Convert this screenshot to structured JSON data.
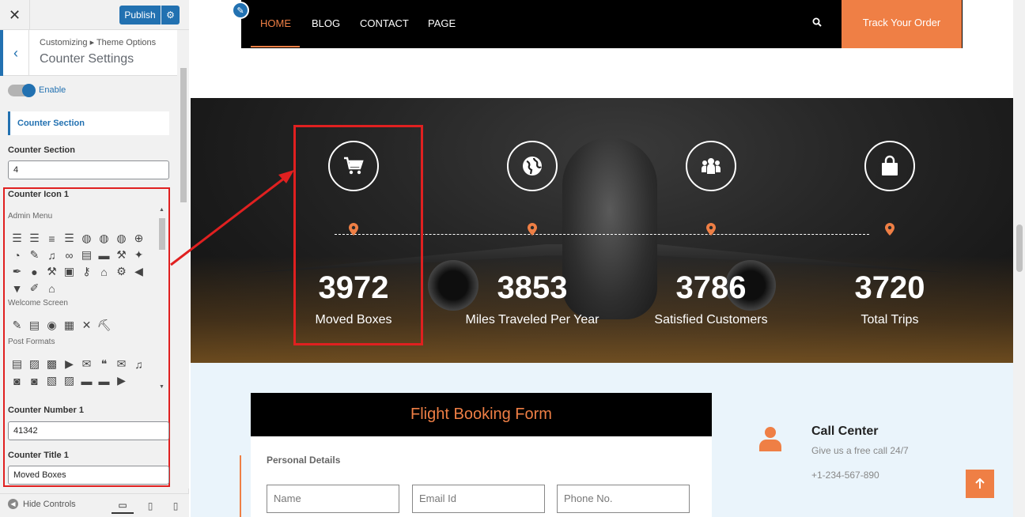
{
  "panel": {
    "close_icon": "close-icon",
    "publish_label": "Publish",
    "breadcrumb": "Customizing ▸ Theme Options",
    "section_title": "Counter Settings",
    "toggle_label": "Enable",
    "counter_section_heading": "Counter Section",
    "counter_section_label": "Counter Section",
    "counter_section_value": "4",
    "counter_icon_label": "Counter Icon 1",
    "icon_groups": [
      {
        "label": "Admin Menu"
      },
      {
        "label": "Welcome Screen"
      },
      {
        "label": "Post Formats"
      }
    ],
    "counter_number_label": "Counter Number 1",
    "counter_number_value": "41342",
    "counter_title_label": "Counter Title 1",
    "counter_title_value": "Moved Boxes",
    "hide_controls": "Hide Controls"
  },
  "nav": {
    "items": [
      "HOME",
      "BLOG",
      "CONTACT",
      "PAGE"
    ],
    "active": "HOME",
    "track_label": "Track Your Order"
  },
  "counters": [
    {
      "icon": "cart-icon",
      "number": "3972",
      "title": "Moved Boxes"
    },
    {
      "icon": "globe-icon",
      "number": "3853",
      "title": "Miles Traveled Per Year"
    },
    {
      "icon": "users-icon",
      "number": "3786",
      "title": "Satisfied Customers"
    },
    {
      "icon": "bag-icon",
      "number": "3720",
      "title": "Total Trips"
    }
  ],
  "booking": {
    "title": "Flight Booking Form",
    "section": "Personal Details",
    "placeholders": [
      "Name",
      "Email Id",
      "Phone No."
    ]
  },
  "contact": {
    "title": "Call Center",
    "subtitle": "Give us a free call 24/7",
    "phone": "+1-234-567-890"
  },
  "colors": {
    "accent": "#ef7f45",
    "wp_blue": "#2271b1",
    "highlight_red": "#e02020"
  }
}
